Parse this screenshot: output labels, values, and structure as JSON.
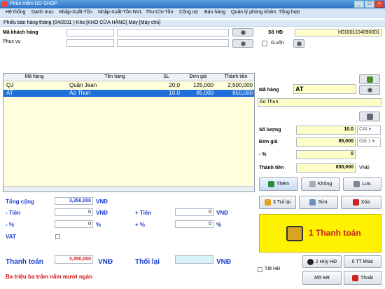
{
  "window": {
    "title": "Phần mềm DD-SHOP"
  },
  "menu": [
    "Hệ thống",
    "Danh mục",
    "Nhập-Xuất-Tồn",
    "Nhập-Xuất-Tồn NVL",
    "Thu-Chi-Tồn",
    "Công nợ",
    "Bán hàng",
    "Quản lý phòng khám",
    "Tổng hợp"
  ],
  "form_header": "Phiếu bán hàng tháng (04/2011 ) Kho [KHO CỬA HÀNG] Máy [Máy chủ]",
  "customer": {
    "label": "Mã khách hàng",
    "service_label": "Phục vụ",
    "code": "",
    "name": "",
    "service": "",
    "service_name": ""
  },
  "invoice": {
    "label": "Số HĐ",
    "number": "H01001104090001",
    "gvon_label": "G.vốn"
  },
  "grid": {
    "columns": [
      "Mã hàng",
      "Tên hàng",
      "SL",
      "Đơn giá",
      "Thành tiền"
    ],
    "rows": [
      [
        "QJ",
        "Quần Jean",
        "20.0",
        "125,000",
        "2,500,000"
      ],
      [
        "AT",
        "Áo Thun",
        "10.0",
        "85,000",
        "850,000"
      ]
    ]
  },
  "item": {
    "code_label": "Mã hàng",
    "code": "AT",
    "name": "Áo Thun",
    "qty_label": "Số lượng",
    "qty": "10.0",
    "unit": "CÁI",
    "price_label": "Đơn giá",
    "price": "85,000",
    "price_level": "Giá 1",
    "pct_label": "- %",
    "pct": "0",
    "amount_label": "Thành tiền",
    "amount": "850,000",
    "currency": "VNĐ"
  },
  "item_buttons": {
    "add": "Thêm",
    "no": "Không",
    "save": "Lưu"
  },
  "totals": {
    "total_label": "Tổng cộng",
    "total": "3,350,000",
    "currency": "VNĐ",
    "minus_money_label": "- Tiền",
    "minus_money": "0",
    "plus_money_label": "+ Tiền",
    "plus_money": "0",
    "minus_pct_label": "- %",
    "minus_pct": "0",
    "plus_pct_label": "+ %",
    "plus_pct": "0",
    "pct_sign": "%",
    "vat_label": "VAT",
    "pay_label": "Thanh toán",
    "pay": "3,350,000",
    "change_label": "Thối lại",
    "change": "",
    "in_words": "Ba triệu ba trăm năm mươi ngàn"
  },
  "actions": {
    "return": "3 Trả lại",
    "edit": "Sửa",
    "delete": "Xóa",
    "pay": "1 Thanh toán",
    "cancel_invoice": "2 Hủy HĐ",
    "other_tt": "0 TT khác",
    "open_drawer": "Mở két",
    "exit": "Thoát",
    "all_invoices": "Tất HĐ"
  }
}
